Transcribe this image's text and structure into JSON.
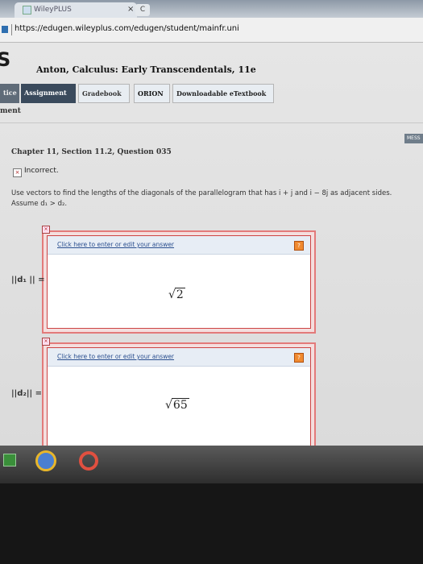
{
  "browser": {
    "tab_title": "WileyPLUS",
    "tab_close": "×",
    "new_tab": "C",
    "url": "https://edugen.wileyplus.com/edugen/student/mainfr.uni"
  },
  "site": {
    "logo": "S",
    "book_title": "Anton, Calculus: Early Transcendentals, 11e"
  },
  "nav": {
    "practice": "tice",
    "assignment": "Assignment",
    "gradebook": "Gradebook",
    "orion": "ORION",
    "etextbook": "Downloadable eTextbook"
  },
  "section_label": "ment",
  "messages_label": "MESS",
  "question": {
    "title": "Chapter 11, Section 11.2, Question 035",
    "status": "Incorrect.",
    "status_icon": "×",
    "prompt_line1": "Use vectors to find the lengths of the diagonals of the parallelogram that has i + j and i − 8j as adjacent sides.",
    "prompt_line2": "Assume d₁ > d₂."
  },
  "answers": [
    {
      "link": "Click here to enter or edit your answer",
      "label": "||d₁ || =",
      "value_radical": "√",
      "value": "2",
      "help": "?",
      "remove": "×"
    },
    {
      "link": "Click here to enter or edit your answer",
      "label": "||d₂|| =",
      "value_radical": "√",
      "value": "65",
      "help": "?",
      "remove": "×"
    }
  ],
  "colors": {
    "incorrect_border": "#e37a7a",
    "nav_active": "#3a4a5c",
    "link": "#2b4f8f"
  }
}
